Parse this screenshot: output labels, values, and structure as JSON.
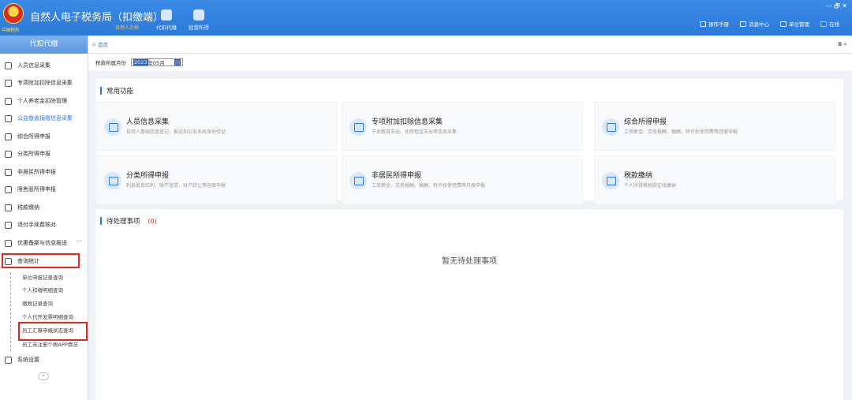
{
  "header": {
    "emblem_text": "中国税务",
    "title": "自然人电子税务局（扣缴端）",
    "subtitle": "自然人办税",
    "nav": [
      {
        "label": "代扣代缴"
      },
      {
        "label": "经营所得"
      }
    ],
    "right_links": [
      {
        "label": "操作手册"
      },
      {
        "label": "消息中心"
      },
      {
        "label": "单位管理"
      },
      {
        "label": "在线"
      }
    ],
    "window_controls": "— 🗗 ✕"
  },
  "sidebar": {
    "title": "代扣代缴",
    "items": [
      {
        "label": "人员信息采集",
        "icon": "user-icon"
      },
      {
        "label": "专项附加扣除信息采集",
        "icon": "grid-icon"
      },
      {
        "label": "个人养老金扣除管理",
        "icon": "card-icon"
      },
      {
        "label": "公益慈善捐赠信息采集",
        "icon": "donation-icon"
      },
      {
        "label": "综合所得申报",
        "icon": "stack-icon"
      },
      {
        "label": "分类所得申报",
        "icon": "pie-icon"
      },
      {
        "label": "非居民所得申报",
        "icon": "person-icon"
      },
      {
        "label": "限售股所得申报",
        "icon": "chart-icon"
      },
      {
        "label": "税款缴纳",
        "icon": "wallet-icon"
      },
      {
        "label": "退付手续费核对",
        "icon": "receipt-icon"
      },
      {
        "label": "优惠备案与信息报送",
        "icon": "doc-icon"
      },
      {
        "label": "查询统计",
        "icon": "query-icon"
      },
      {
        "label": "系统设置",
        "icon": "gear-icon"
      }
    ],
    "sub_items": [
      {
        "label": "单位申报记录查询"
      },
      {
        "label": "个人扣缴明细查询"
      },
      {
        "label": "缴税记录查询"
      },
      {
        "label": "个人代开发票明细查询"
      },
      {
        "label": "员工汇算申报状态查询"
      },
      {
        "label": "员工未注册个税APP情况"
      }
    ],
    "collapse": "«"
  },
  "main": {
    "breadcrumb": "首页",
    "tab_controls": "◘ ✕",
    "period_label": "税款所属月份",
    "period_year": "2023",
    "period_rest": "年05月",
    "common_title": "常用功能",
    "cards": [
      {
        "title": "人员信息采集",
        "desc": "自然人基础信息登记、报送和公安系统身份验证"
      },
      {
        "title": "专项附加扣除信息采集",
        "desc": "子女教育支出、住房租金支出等信息采集"
      },
      {
        "title": "综合所得申报",
        "desc": "工资薪金、劳务报酬、稿酬、特许权使用费等月度申报"
      },
      {
        "title": "分类所得申报",
        "desc": "利息股息红利、财产租赁、财产转让等月度申报"
      },
      {
        "title": "非居民所得申报",
        "desc": "工资薪金、劳务报酬、稿酬、特许权使用费等月度申报"
      },
      {
        "title": "税款缴纳",
        "desc": "个人所得税税款在线缴纳"
      }
    ],
    "pending_title": "待处理事项",
    "pending_count": "(0)",
    "pending_empty": "暂无待处理事项"
  },
  "colors": {
    "topbar": "#2d7ad8",
    "accent": "#2d7ad8",
    "highlight": "#e8261b"
  }
}
